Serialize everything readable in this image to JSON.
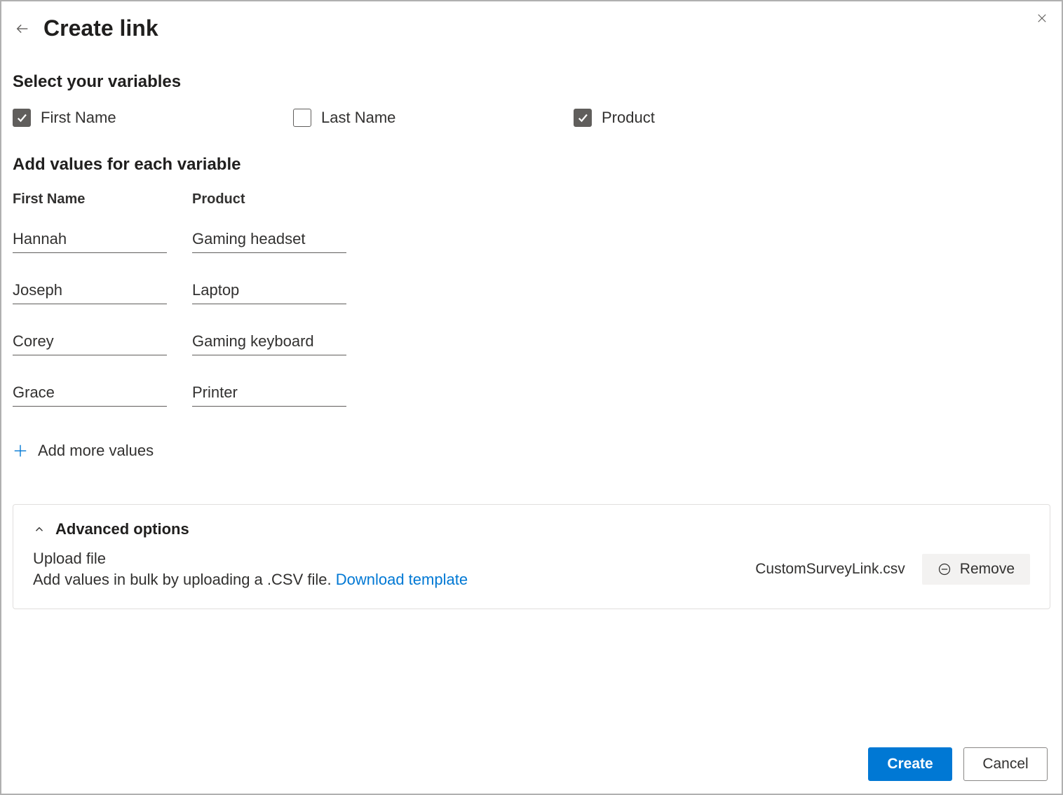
{
  "header": {
    "title": "Create link"
  },
  "variables": {
    "heading": "Select your variables",
    "items": [
      {
        "label": "First Name",
        "checked": true
      },
      {
        "label": "Last Name",
        "checked": false
      },
      {
        "label": "Product",
        "checked": true
      }
    ]
  },
  "values": {
    "heading": "Add values for each variable",
    "columns": [
      "First Name",
      "Product"
    ],
    "rows": [
      {
        "first_name": "Hannah",
        "product": "Gaming headset"
      },
      {
        "first_name": "Joseph",
        "product": "Laptop"
      },
      {
        "first_name": "Corey",
        "product": "Gaming keyboard"
      },
      {
        "first_name": "Grace",
        "product": "Printer"
      }
    ],
    "add_more_label": "Add more values"
  },
  "advanced": {
    "title": "Advanced options",
    "upload_label": "Upload file",
    "upload_desc_prefix": "Add values in bulk by uploading a .CSV file. ",
    "download_link": "Download template",
    "file_name": "CustomSurveyLink.csv",
    "remove_label": "Remove"
  },
  "footer": {
    "create_label": "Create",
    "cancel_label": "Cancel"
  }
}
